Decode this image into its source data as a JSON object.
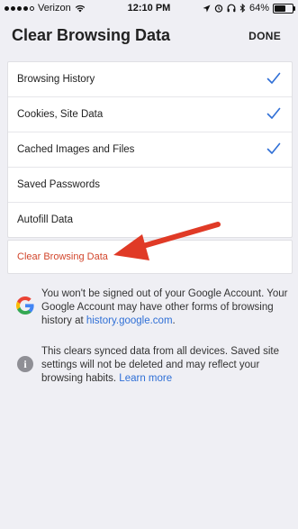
{
  "status_bar": {
    "carrier": "Verizon",
    "time": "12:10 PM",
    "battery": "64%",
    "battery_level": 0.64
  },
  "header": {
    "title": "Clear Browsing Data",
    "done_label": "DONE"
  },
  "options": [
    {
      "label": "Browsing History",
      "checked": true
    },
    {
      "label": "Cookies, Site Data",
      "checked": true
    },
    {
      "label": "Cached Images and Files",
      "checked": true
    },
    {
      "label": "Saved Passwords",
      "checked": false
    },
    {
      "label": "Autofill Data",
      "checked": false
    }
  ],
  "clear_button": {
    "label": "Clear Browsing Data"
  },
  "info_google": {
    "text": "You won't be signed out of your Google Account. Your Google Account may have other forms of browsing history at ",
    "link": "history.google.com",
    "suffix": "."
  },
  "info_sync": {
    "text": "This clears synced data from all devices. Saved site settings will not be deleted and may reflect your browsing habits. ",
    "link": "Learn more"
  },
  "colors": {
    "accent_blue": "#2f6fd6",
    "destructive_red": "#d2462c",
    "annotation_arrow": "#e03a26"
  },
  "icons": {
    "check": "checkmark-icon",
    "google": "google-g-icon",
    "info": "info-icon"
  }
}
